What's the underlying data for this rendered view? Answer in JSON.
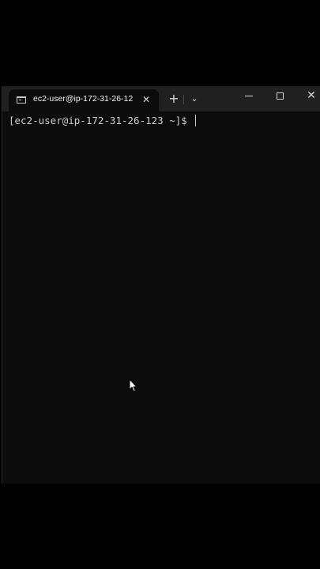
{
  "window": {
    "tab_title": "ec2-user@ip-172-31-26-12",
    "tab_close_glyph": "✕",
    "new_tab_glyph": "+",
    "dropdown_glyph": "⌄",
    "close_glyph": "✕",
    "icons": [
      "terminal-icon",
      "close-icon",
      "plus-icon",
      "chevron-down-icon",
      "minimize-icon",
      "maximize-icon",
      "close-icon"
    ]
  },
  "terminal": {
    "prompt": "[ec2-user@ip-172-31-26-123 ~]$ ",
    "foreground": "#cccccc",
    "background": "#0c0c0c"
  },
  "colors": {
    "titlebar": "#202020",
    "page_background": "#000000"
  }
}
